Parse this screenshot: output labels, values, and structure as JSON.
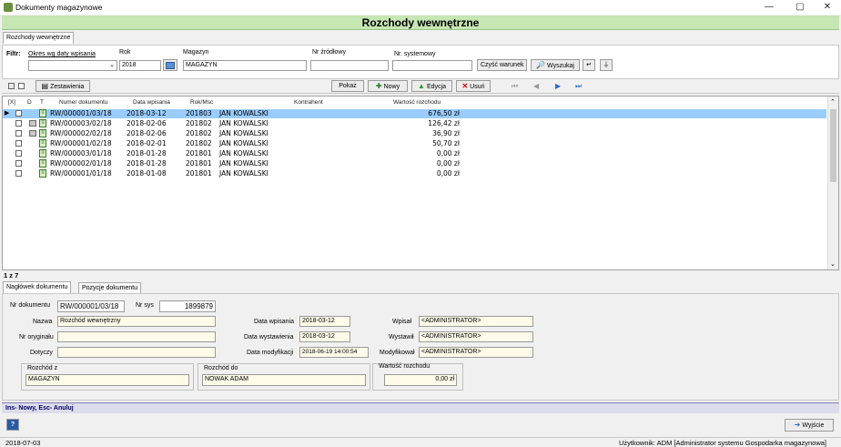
{
  "window": {
    "title": "Dokumenty magazynowe",
    "min": "—",
    "restore": "▢",
    "close": "✕"
  },
  "banner": {
    "title": "Rozchody wewnętrzne"
  },
  "main_tab": "Rozchody wewnętrzne",
  "filter": {
    "label": "Filtr:",
    "period_label": "Okres wg daty wpisania",
    "period_value": "",
    "rok_label": "Rok",
    "rok_value": "2018",
    "magazyn_label": "Magazyn",
    "magazyn_value": "MAGAZYN",
    "nr_zrodlowy_label": "Nr źródłowy",
    "nr_zrodlowy_value": "",
    "nr_systemowy_label": "Nr. systemowy",
    "nr_systemowy_value": "",
    "clear_label": "Czyść warunek",
    "search_label": "Wyszukaj"
  },
  "toolbar": {
    "zestawienia": "Zestawienia",
    "pokaz": "Pokaż",
    "nowy": "Nowy",
    "edycja": "Edycja",
    "usun": "Usuń"
  },
  "grid": {
    "headers": [
      "[X]",
      "D",
      "T",
      "Numer dokumentu",
      "Data wpisania",
      "Rok/Msc",
      "Kontrahent",
      "Wartość rozchodu"
    ],
    "rows": [
      {
        "num": "RW/000001/03/18",
        "date": "2018-03-12",
        "rokmsc": "201803",
        "kontrahent": "JAN KOWALSKI",
        "value": "676,50 zł",
        "printed": false,
        "selected": true
      },
      {
        "num": "RW/000003/02/18",
        "date": "2018-02-06",
        "rokmsc": "201802",
        "kontrahent": "JAN KOWALSKI",
        "value": "126,42 zł",
        "printed": true,
        "selected": false
      },
      {
        "num": "RW/000002/02/18",
        "date": "2018-02-06",
        "rokmsc": "201802",
        "kontrahent": "JAN KOWALSKI",
        "value": "36,90 zł",
        "printed": true,
        "selected": false
      },
      {
        "num": "RW/000001/02/18",
        "date": "2018-02-01",
        "rokmsc": "201802",
        "kontrahent": "JAN KOWALSKI",
        "value": "50,70 zł",
        "printed": false,
        "selected": false
      },
      {
        "num": "RW/000003/01/18",
        "date": "2018-01-28",
        "rokmsc": "201801",
        "kontrahent": "JAN KOWALSKI",
        "value": "0,00 zł",
        "printed": false,
        "selected": false
      },
      {
        "num": "RW/000002/01/18",
        "date": "2018-01-28",
        "rokmsc": "201801",
        "kontrahent": "JAN KOWALSKI",
        "value": "0,00 zł",
        "printed": false,
        "selected": false
      },
      {
        "num": "RW/000001/01/18",
        "date": "2018-01-08",
        "rokmsc": "201801",
        "kontrahent": "JAN KOWALSKI",
        "value": "0,00 zł",
        "printed": false,
        "selected": false
      }
    ]
  },
  "record_info": "1 z 7",
  "detail_tabs": [
    "Nagłówek dokumentu",
    "Pozycje dokumentu"
  ],
  "detail": {
    "nr_dok_label": "Nr dokumentu",
    "nr_dok_value": "RW/000001/03/18",
    "nr_sys_label": "Nr sys",
    "nr_sys_value": "1899879",
    "nazwa_label": "Nazwa",
    "nazwa_value": "Rozchód wewnętrzny",
    "nr_oryg_label": "Nr oryginału",
    "nr_oryg_value": "",
    "dotyczy_label": "Dotyczy",
    "dotyczy_value": "",
    "data_wpis_label": "Data wpisania",
    "data_wpis_value": "2018-03-12",
    "data_wyst_label": "Data wystawienia",
    "data_wyst_value": "2018-03-12",
    "data_mod_label": "Data modyfikacji",
    "data_mod_value": "2018-06-19 14:00:54",
    "wpisal_label": "Wpisał",
    "wpisal_value": "<ADMINISTRATOR>",
    "wystawil_label": "Wystawił",
    "wystawil_value": "<ADMINISTRATOR>",
    "modyfikowal_label": "Modyfikował",
    "modyfikowal_value": "<ADMINISTRATOR>",
    "rozchod_z_label": "Rozchód z",
    "rozchod_z_value": "MAGAZYN",
    "rozchod_do_label": "Rozchód do",
    "rozchod_do_value": "NOWAK ADAM",
    "wartosc_label": "Wartość rozchodu",
    "wartosc_value": "0,00 zł"
  },
  "hint": "Ins- Nowy, Esc- Anuluj",
  "bottom": {
    "help": "?",
    "exit": "Wyjście"
  },
  "status": {
    "date": "2018-07-03",
    "user": "Użytkownik: ADM [Administrator systemu Gospodarka magazynowa]"
  },
  "colors": {
    "banner": "#c6e6b4",
    "selected_row": "#99ccff",
    "input_highlight": "#fffbe8"
  }
}
